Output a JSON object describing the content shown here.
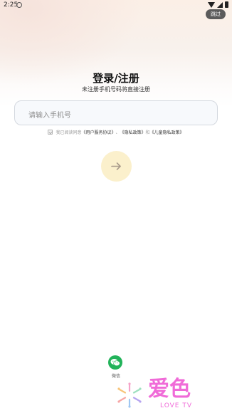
{
  "status_bar": {
    "time": "2:25"
  },
  "header": {
    "skip_label": "跳过"
  },
  "main": {
    "title": "登录/注册",
    "subtitle": "未注册手机号码将直接注册",
    "phone_placeholder": "请输入手机号",
    "agreement": {
      "prefix": "我已阅读同意",
      "user_agreement": "《用户服务协议》",
      "separator": "、",
      "privacy_policy": "《隐私政策》",
      "conjunction": "和",
      "children_privacy": "《儿童隐私政策》"
    }
  },
  "third_party": {
    "wechat_label": "微信"
  },
  "watermark": {
    "title": "爱色",
    "subtitle": "LOVE TV"
  },
  "colors": {
    "accent_disabled": "#fbf0cc",
    "wechat": "#22b35a",
    "watermark": "#f06bd8",
    "skip_bg": "#5b5b5b"
  },
  "icons": [
    "status-extra-icon",
    "wifi-icon",
    "signal-icon",
    "battery-icon",
    "checkbox-icon",
    "arrow-right-icon",
    "wechat-icon",
    "watermark-logo-icon"
  ]
}
